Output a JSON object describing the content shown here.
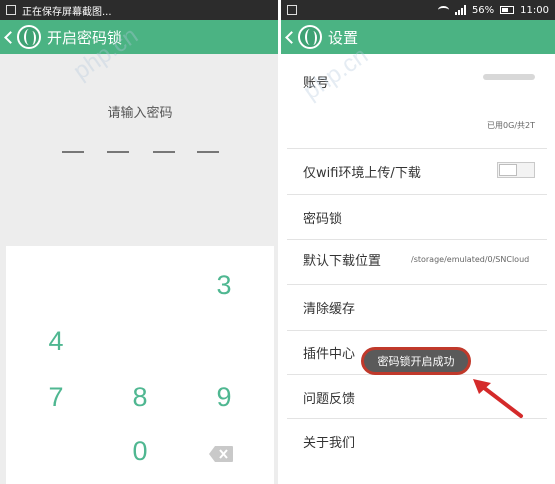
{
  "left": {
    "status_text": "正在保存屏幕截图...",
    "title": "开启密码锁",
    "prompt": "请输入密码",
    "keys": [
      "3",
      "4",
      "7",
      "8",
      "9",
      "0"
    ]
  },
  "right": {
    "status": {
      "battery": "56%",
      "time": "11:00"
    },
    "title": "设置",
    "items": {
      "account": "账号",
      "storage": "已用0G/共2T",
      "wifi_only": "仅wifi环境上传/下载",
      "password_lock": "密码锁",
      "download_location": "默认下载位置",
      "download_path": "/storage/emulated/0/SNCloud",
      "clear_cache": "清除缓存",
      "plugins": "插件中心",
      "feedback": "问题反馈",
      "about": "关于我们"
    },
    "toast": "密码锁开启成功"
  },
  "watermark": "php.cn",
  "colors": {
    "accent": "#4bb383",
    "keypad_digit": "#4fb791",
    "highlight": "#c0392b"
  }
}
